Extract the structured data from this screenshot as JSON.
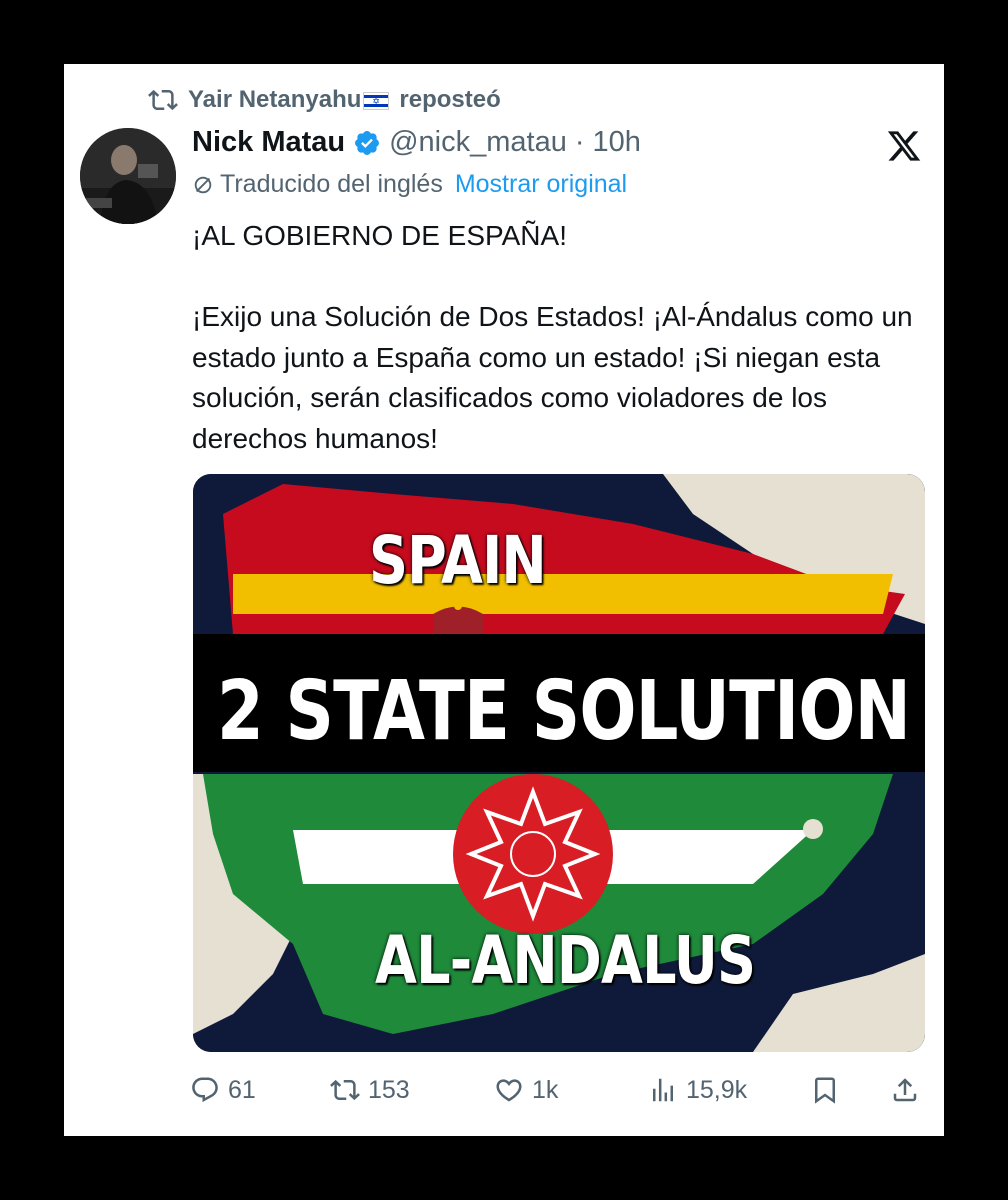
{
  "repost": {
    "user": "Yair Netanyahu",
    "flag": "✡",
    "label": "reposteó"
  },
  "tweet": {
    "name": "Nick Matau",
    "handle": "@nick_matau",
    "separator": "·",
    "time": "10h",
    "translated_label": "Traducido del inglés",
    "show_original": "Mostrar original",
    "text": "¡AL GOBIERNO DE ESPAÑA!\n\n¡Exijo una Solución de Dos Estados! ¡Al-Ándalus como un estado junto a España como un estado! ¡Si niegan esta solución, serán clasificados como violadores de los derechos humanos!"
  },
  "media": {
    "top_label": "SPAIN",
    "main_label": "2 STATE SOLUTION",
    "bottom_label": "AL-ANDALUS",
    "colors": {
      "sea": "#0f1a3a",
      "land": "#e5e0d2",
      "spain_red": "#c60b1e",
      "spain_yellow": "#f1bf00",
      "andalus_green": "#1e8a3a",
      "andalus_white": "#ffffff"
    }
  },
  "actions": {
    "replies": "61",
    "reposts": "153",
    "likes": "1k",
    "views": "15,9k"
  },
  "icons": {
    "repost": "repost-icon",
    "verified": "verified-badge-icon",
    "platform": "x-logo-icon",
    "translate": "translate-icon",
    "reply": "reply-icon",
    "like": "heart-icon",
    "views": "views-icon",
    "bookmark": "bookmark-icon",
    "share": "share-icon"
  },
  "accent": "#1d9bf0"
}
